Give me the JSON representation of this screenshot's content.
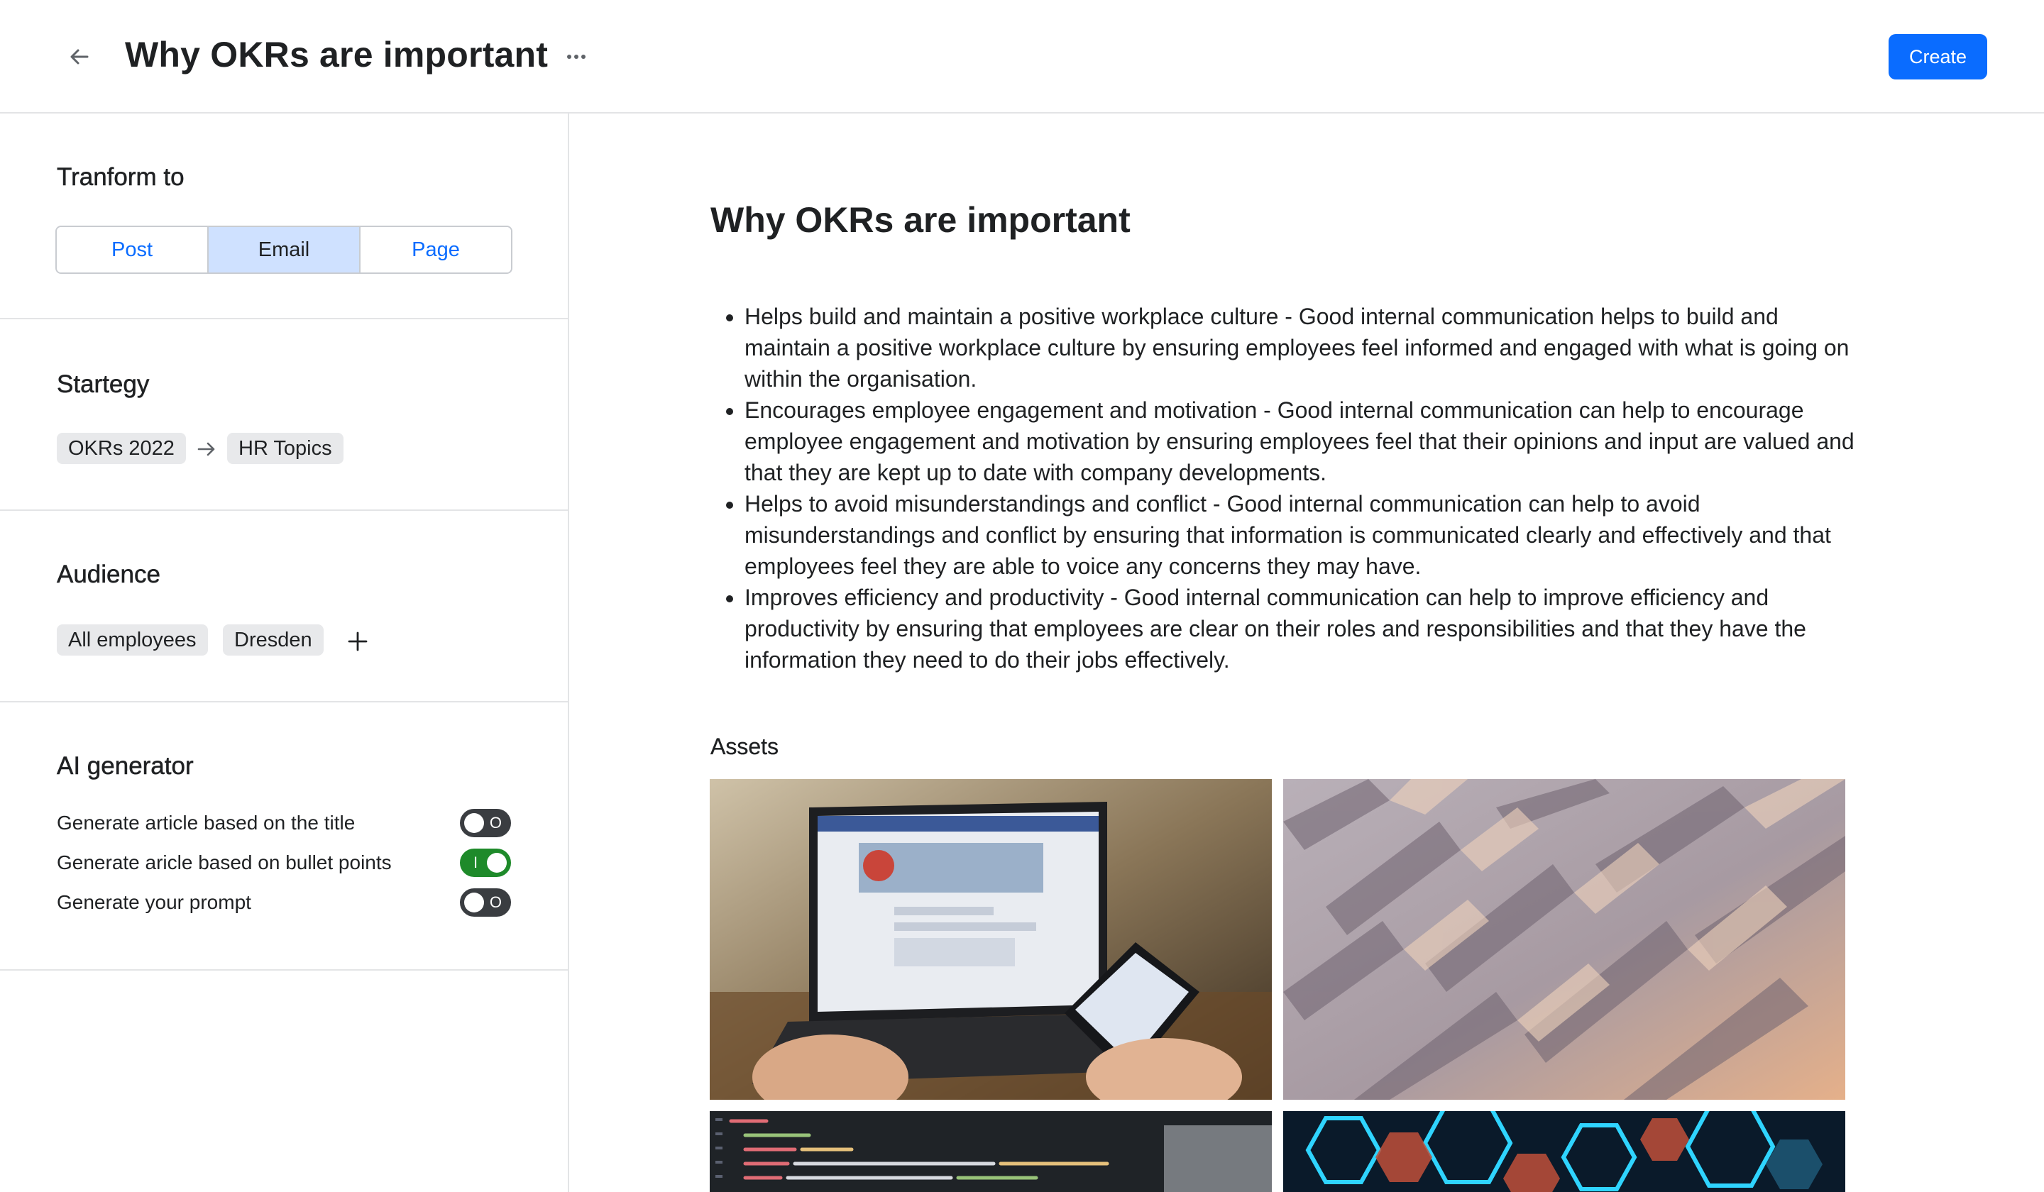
{
  "header": {
    "title": "Why OKRs are important",
    "create_label": "Create"
  },
  "sidebar": {
    "transform": {
      "title": "Tranform to",
      "options": [
        "Post",
        "Email",
        "Page"
      ],
      "selected": "Email"
    },
    "strategy": {
      "title": "Startegy",
      "from": "OKRs 2022",
      "to": "HR Topics"
    },
    "audience": {
      "title": "Audience",
      "tags": [
        "All employees",
        "Dresden"
      ]
    },
    "ai": {
      "title": "AI generator",
      "toggles": [
        {
          "label": "Generate article based on the title",
          "on": false,
          "mark": "O"
        },
        {
          "label": "Generate aricle based on bullet points",
          "on": true,
          "mark": "I"
        },
        {
          "label": "Generate your prompt",
          "on": false,
          "mark": "O"
        }
      ]
    }
  },
  "main": {
    "title": "Why OKRs are important",
    "bullets": [
      "Helps build and maintain a positive workplace culture - Good internal communication helps to build and maintain a positive workplace culture by ensuring employees feel informed and engaged with what is going on within the organisation.",
      "Encourages employee engagement and motivation - Good internal communication can help to encourage employee engagement and motivation by ensuring employees feel that their opinions and input are valued and that they are kept up to date with company developments.",
      "Helps to avoid misunderstandings and conflict - Good internal communication can help to avoid misunderstandings and conflict by ensuring that information is communicated clearly and effectively and that employees feel they are able to voice any concerns they may have.",
      "Improves efficiency and productivity - Good internal communication can help to improve efficiency and productivity by ensuring that employees are clear on their roles and responsibilities and that they have the information they need to do their jobs effectively."
    ],
    "assets_label": "Assets"
  },
  "colors": {
    "accent": "#0a6cff",
    "selected_segment": "#cfe1ff",
    "toggle_on": "#1e8a2a",
    "toggle_off": "#3a3d41",
    "chip": "#e8e9eb",
    "divider": "#e3e4e6"
  },
  "icons": {
    "back": "arrow-left-icon",
    "more": "more-horizontal-icon",
    "strategy_arrow": "arrow-right-icon",
    "add": "plus-icon"
  }
}
